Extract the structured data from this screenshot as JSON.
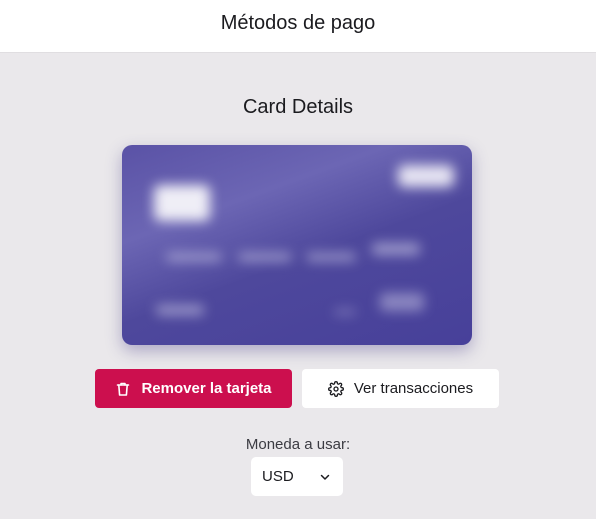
{
  "header": {
    "title": "Métodos de pago"
  },
  "card_section": {
    "title": "Card Details"
  },
  "actions": {
    "remove_label": "Remover la tarjeta",
    "transactions_label": "Ver transacciones"
  },
  "currency": {
    "label": "Moneda a usar:",
    "selected": "USD"
  },
  "icons": {
    "remove": "trash-icon",
    "transactions": "gear-icon",
    "select": "chevron-down-icon"
  },
  "colors": {
    "accent": "#cc0f4e",
    "card": "#4e489c",
    "background": "#eae8eb"
  }
}
